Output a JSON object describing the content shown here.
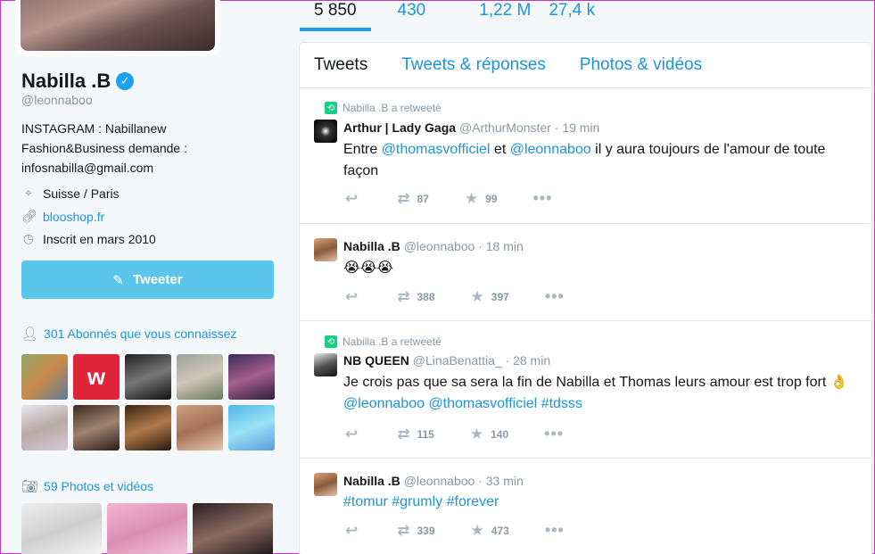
{
  "profile": {
    "name": "Nabilla .B",
    "handle": "@leonnaboo",
    "bio_lines": [
      "INSTAGRAM : Nabillanew",
      "Fashion&Business demande :",
      "infosnabilla@gmail.com"
    ],
    "location": "Suisse / Paris",
    "website": "blooshop.fr",
    "joined": "Inscrit en mars 2010",
    "tweet_button": "Tweeter",
    "followers_known": "301 Abonnés que vous connaissez",
    "photos_videos": "59 Photos et vidéos"
  },
  "stats": [
    "5 850",
    "430",
    "1,22 M",
    "27,4 k"
  ],
  "tabs": [
    "Tweets",
    "Tweets & réponses",
    "Photos & vidéos"
  ],
  "tweets": [
    {
      "retweet_label": "Nabilla .B a retweeté",
      "name": "Arthur | Lady Gaga",
      "handle": "@ArthurMonster",
      "time": "· 19 min",
      "text_parts": [
        {
          "t": "Entre ",
          "h": false
        },
        {
          "t": "@thomasvofficiel",
          "h": true
        },
        {
          "t": " et ",
          "h": false
        },
        {
          "t": "@leonnaboo",
          "h": true
        },
        {
          "t": " il y aura toujours de l'amour de toute façon",
          "h": false
        }
      ],
      "retweets": "87",
      "likes": "99"
    },
    {
      "retweet_label": "",
      "name": "Nabilla .B",
      "handle": "@leonnaboo",
      "time": "· 18 min",
      "text_parts": [
        {
          "t": "😭😭😭",
          "h": false
        }
      ],
      "retweets": "388",
      "likes": "397"
    },
    {
      "retweet_label": "Nabilla .B a retweeté",
      "name": "NB QUEEN",
      "handle": "@LinaBenattia_",
      "time": "· 28 min",
      "text_parts": [
        {
          "t": "Je crois pas que sa sera la fin de Nabilla et Thomas leurs amour est trop fort 👌 ",
          "h": false
        },
        {
          "t": "@leonnaboo",
          "h": true
        },
        {
          "t": " ",
          "h": false
        },
        {
          "t": "@thomasvofficiel",
          "h": true
        },
        {
          "t": " ",
          "h": false
        },
        {
          "t": "#tdsss",
          "h": true
        }
      ],
      "retweets": "115",
      "likes": "140"
    },
    {
      "retweet_label": "",
      "name": "Nabilla .B",
      "handle": "@leonnaboo",
      "time": "· 33 min",
      "text_parts": [
        {
          "t": "#tomur",
          "h": true
        },
        {
          "t": " ",
          "h": false
        },
        {
          "t": "#grumly",
          "h": true
        },
        {
          "t": " ",
          "h": false
        },
        {
          "t": "#forever",
          "h": true
        }
      ],
      "retweets": "339",
      "likes": "473"
    }
  ],
  "colors": {
    "accent": "#1b95e0",
    "tweet_button": "#5bc6ec",
    "retweet_green": "#19cf86",
    "background": "#f5f8fa"
  },
  "icons": {
    "verified": "verified-badge-icon",
    "location": "location-pin-icon",
    "link": "link-icon",
    "calendar": "clock-icon",
    "compose": "quill-icon",
    "followers": "person-icon",
    "camera": "camera-icon",
    "reply": "reply-icon",
    "retweet": "retweet-icon",
    "like": "star-icon",
    "more": "more-dots-icon"
  }
}
